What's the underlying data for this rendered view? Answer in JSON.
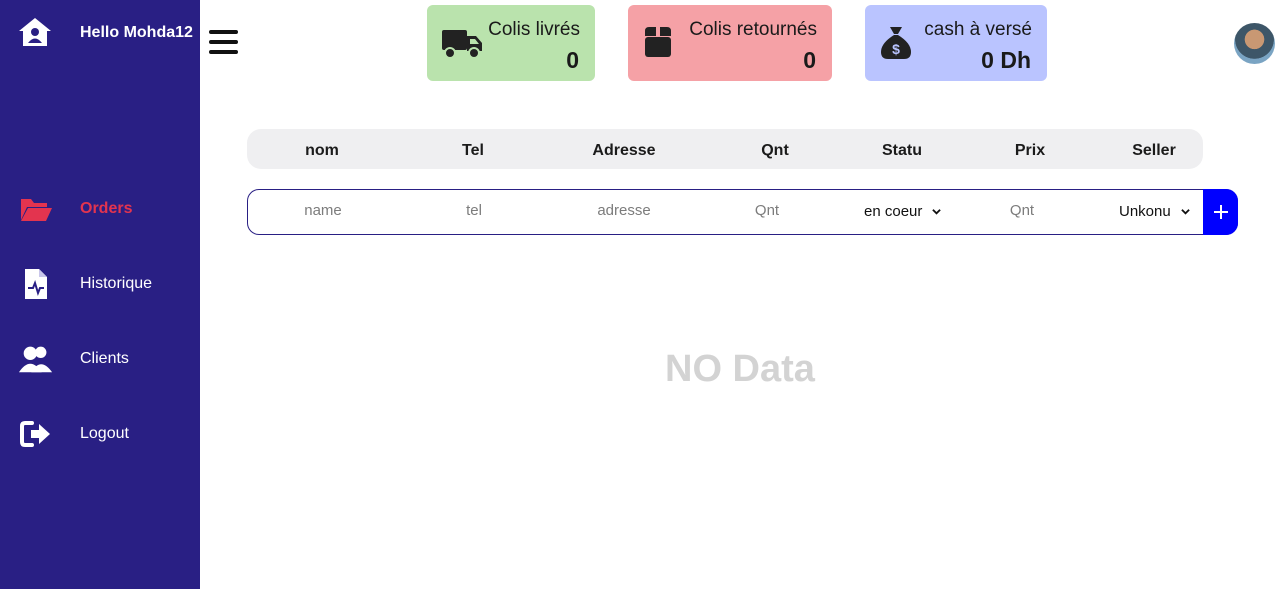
{
  "sidebar": {
    "greeting": "Hello Mohda12",
    "brand_icon": "home-user-icon",
    "background": "#291f84",
    "active_color": "#e3344f",
    "items": [
      {
        "label": "Orders",
        "icon": "folder-open-icon",
        "active": true
      },
      {
        "label": "Historique",
        "icon": "file-medical-icon",
        "active": false
      },
      {
        "label": "Clients",
        "icon": "users-icon",
        "active": false
      },
      {
        "label": "Logout",
        "icon": "sign-out-icon",
        "active": false
      }
    ]
  },
  "header": {
    "menu_icon": "hamburger-icon",
    "avatar_icon": "user-avatar"
  },
  "stats": [
    {
      "title": "Colis livrés",
      "value": "0",
      "icon": "truck-icon",
      "color": "#bae3ad"
    },
    {
      "title": "Colis retournés",
      "value": "0",
      "icon": "box-icon",
      "color": "#f5a1a6"
    },
    {
      "title": "cash à versé",
      "value": "0 Dh",
      "icon": "money-bag-icon",
      "color": "#bac4ff"
    }
  ],
  "table": {
    "headers": [
      "nom",
      "Tel",
      "Adresse",
      "Qnt",
      "Statu",
      "Prix",
      "Seller"
    ],
    "form": {
      "name_placeholder": "name",
      "tel_placeholder": "tel",
      "address_placeholder": "adresse",
      "qnt_placeholder": "Qnt",
      "status_value": "en coeur",
      "price_placeholder": "Qnt",
      "seller_value": "Unkonu",
      "add_label": "+",
      "add_color": "#0000ff"
    },
    "empty_text": "NO Data"
  }
}
